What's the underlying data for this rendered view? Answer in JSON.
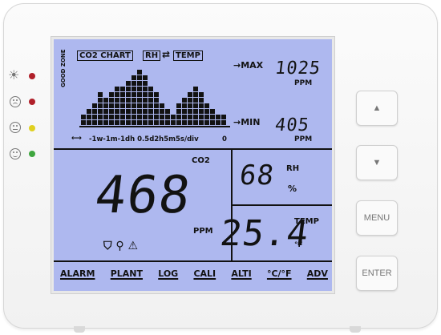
{
  "lcd": {
    "chart_tab": "CO2 CHART",
    "rh_temp_tab": "RH",
    "temp_tab": "TEMP",
    "swap_symbol": "⇄",
    "max_label": "→MAX",
    "min_label": "→MIN",
    "good_zone": "GOOD ZONE",
    "max_value": "1025",
    "min_value": "405",
    "max_unit": "PPM",
    "min_unit": "PPM",
    "timescale": "-1w-1m-1dh   0.5d2h5m5s/div",
    "zero_tick": "0",
    "co2_label": "CO2",
    "co2_value": "468",
    "co2_unit": "PPM",
    "rh_value": "68",
    "rh_label": "RH",
    "rh_unit": "%",
    "temp_value": "25.4",
    "temp_label": "TEMP",
    "temp_unit": "°F",
    "status_icons": "⛉ ⚲ ⚠",
    "menu": [
      "ALARM",
      "PLANT",
      "LOG",
      "CALI",
      "ALTI",
      "°C/°F",
      "ADV"
    ]
  },
  "buttons": {
    "up": "▲",
    "down": "▼",
    "menu": "MENU",
    "enter": "ENTER"
  },
  "indicators": [
    {
      "face": "sun",
      "color": "#b0202a"
    },
    {
      "face": "sad",
      "color": "#b0202a"
    },
    {
      "face": "neutral",
      "color": "#e0d020"
    },
    {
      "face": "happy",
      "color": "#3fa63f"
    }
  ],
  "chart_data": {
    "type": "bar",
    "bar_heights": [
      2,
      3,
      4,
      6,
      5,
      6,
      7,
      7,
      8,
      9,
      10,
      9,
      7,
      6,
      4,
      3,
      2,
      4,
      5,
      6,
      7,
      6,
      4,
      3,
      2,
      2
    ]
  }
}
